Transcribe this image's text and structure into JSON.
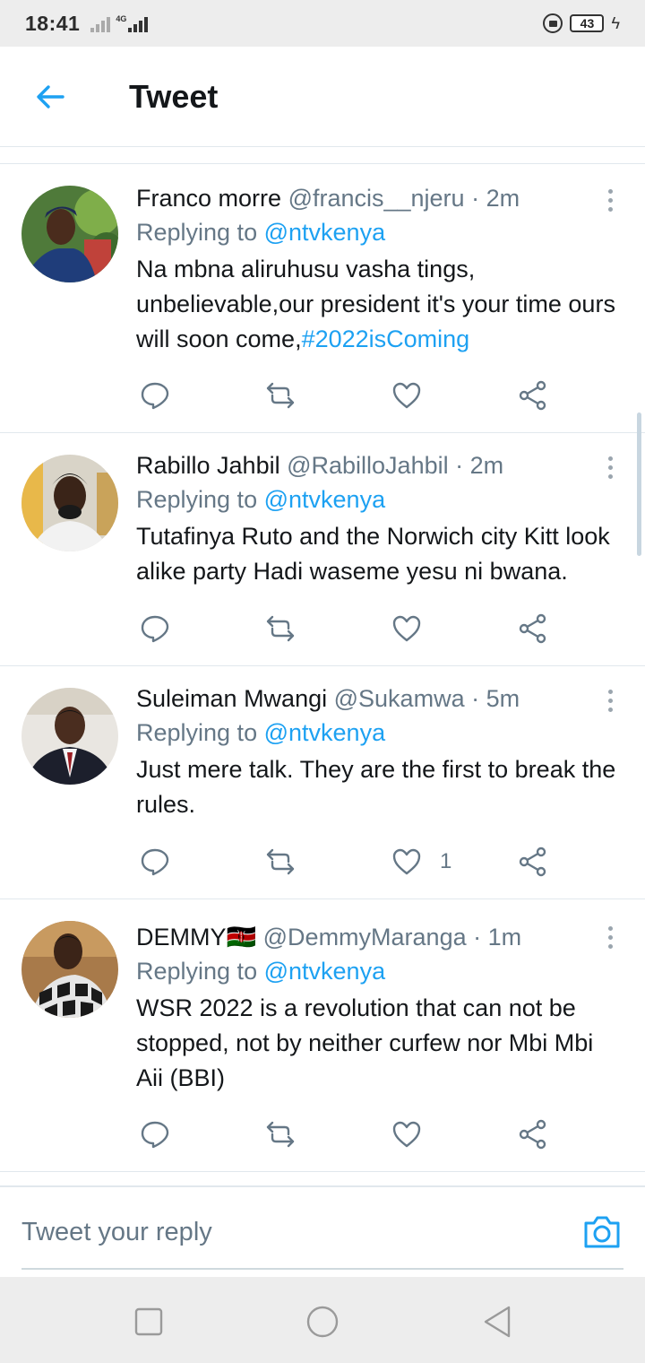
{
  "status_bar": {
    "time": "18:41",
    "network": "4G",
    "battery": "43"
  },
  "header": {
    "title": "Tweet"
  },
  "tweets": [
    {
      "name": "Franco morre",
      "handle": "@francis__njeru",
      "dot": "·",
      "time": "2m",
      "replying_prefix": "Replying to",
      "replying_to": "@ntvkenya",
      "text": "Na mbna aliruhusu vasha tings, unbelievable,our president it's your time ours will soon come,",
      "hashtag": "#2022isComing",
      "like_count": ""
    },
    {
      "name": "Rabillo Jahbil",
      "handle": "@RabilloJahbil",
      "dot": "·",
      "time": "2m",
      "replying_prefix": "Replying to",
      "replying_to": "@ntvkenya",
      "text": "Tutafinya Ruto and the Norwich city Kitt look alike party Hadi waseme yesu ni bwana.",
      "hashtag": "",
      "like_count": ""
    },
    {
      "name": "Suleiman Mwangi",
      "handle": "@Sukamwa",
      "dot": "·",
      "time": "5m",
      "replying_prefix": "Replying to",
      "replying_to": "@ntvkenya",
      "text": "Just mere talk. They are the first to break the rules.",
      "hashtag": "",
      "like_count": "1"
    },
    {
      "name": "DEMMY",
      "flag": "🇰🇪",
      "handle": "@DemmyMaranga",
      "dot": "·",
      "time": "1m",
      "replying_prefix": "Replying to",
      "replying_to": "@ntvkenya",
      "text": "WSR 2022 is a revolution that can not be stopped, not by neither curfew nor Mbi Mbi Aii (BBI)",
      "hashtag": "",
      "like_count": ""
    }
  ],
  "reply_bar": {
    "placeholder": "Tweet your reply"
  },
  "colors": {
    "accent": "#1da1f2",
    "secondary_text": "#657786",
    "divider": "#e1e8ed"
  },
  "icons": [
    "back-arrow-icon",
    "reply-icon",
    "retweet-icon",
    "like-icon",
    "share-icon",
    "more-vertical-icon",
    "camera-icon",
    "square-nav-icon",
    "circle-nav-icon",
    "triangle-nav-icon"
  ]
}
